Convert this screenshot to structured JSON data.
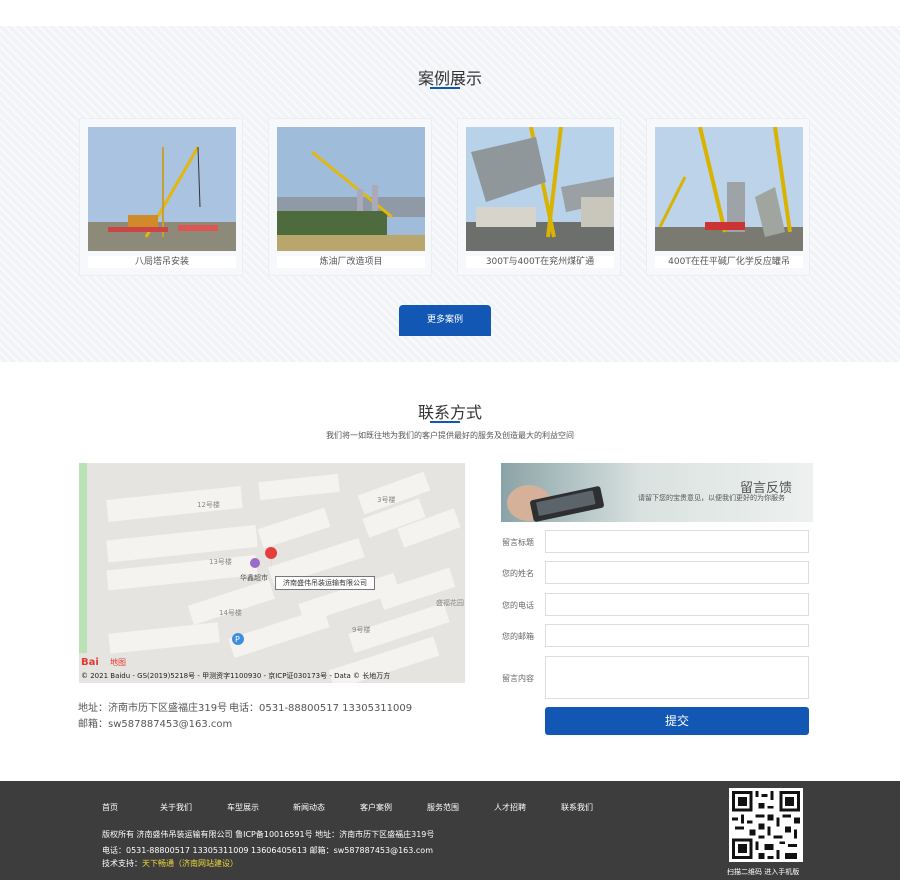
{
  "cases": {
    "title": "案例展示",
    "items": [
      {
        "label": "八局塔吊安装"
      },
      {
        "label": "炼油厂改造项目"
      },
      {
        "label": "300T与400T在兖州煤矿通"
      },
      {
        "label": "400T在茌平碱厂化学反应罐吊"
      }
    ],
    "more_label": "更多案例"
  },
  "contact": {
    "title": "联系方式",
    "subtitle": "我们将一如既往地为我们的客户提供最好的服务及创造最大的利益空间",
    "map": {
      "labels": [
        "12号楼",
        "3号楼",
        "13号楼",
        "华鑫超市",
        "14号楼",
        "9号楼",
        "盛福花园"
      ],
      "tooltip": "济南盛伟吊装运输有限公司",
      "logo": "Bai",
      "logo_suffix": "地图",
      "copyright": "© 2021 Baidu - GS(2019)5218号 - 甲测资字1100930 - 京ICP证030173号 - Data © 长地万方"
    },
    "address": "地址：济南市历下区盛福庄319号",
    "phone": "电话：0531-88800517 13305311009",
    "email": "邮箱：sw587887453@163.com"
  },
  "form": {
    "banner_title": "留言反馈",
    "banner_sub": "请留下您的宝贵意见，以便我们更好的为你服务",
    "fields": [
      {
        "label": "留言标题"
      },
      {
        "label": "您的姓名"
      },
      {
        "label": "您的电话"
      },
      {
        "label": "您的邮箱"
      },
      {
        "label": "留言内容"
      }
    ],
    "submit_label": "提交"
  },
  "footer": {
    "nav": [
      "首页",
      "关于我们",
      "车型展示",
      "新闻动态",
      "客户案例",
      "服务范围",
      "人才招聘",
      "联系我们"
    ],
    "copyright": "版权所有 济南盛伟吊装运输有限公司  鲁ICP备10016591号   地址：济南市历下区盛福庄319号",
    "contact": "电话：0531-88800517  13305311009  13606405613  邮箱：sw587887453@163.com",
    "support_prefix": "技术支持：",
    "support_link": "天下畅通（济南网站建设）",
    "qr_caption": "扫描二维码 进入手机版"
  },
  "colors": {
    "accent": "#1357b5",
    "footer_bg": "#3d3d3d",
    "link": "#f1d93b"
  }
}
